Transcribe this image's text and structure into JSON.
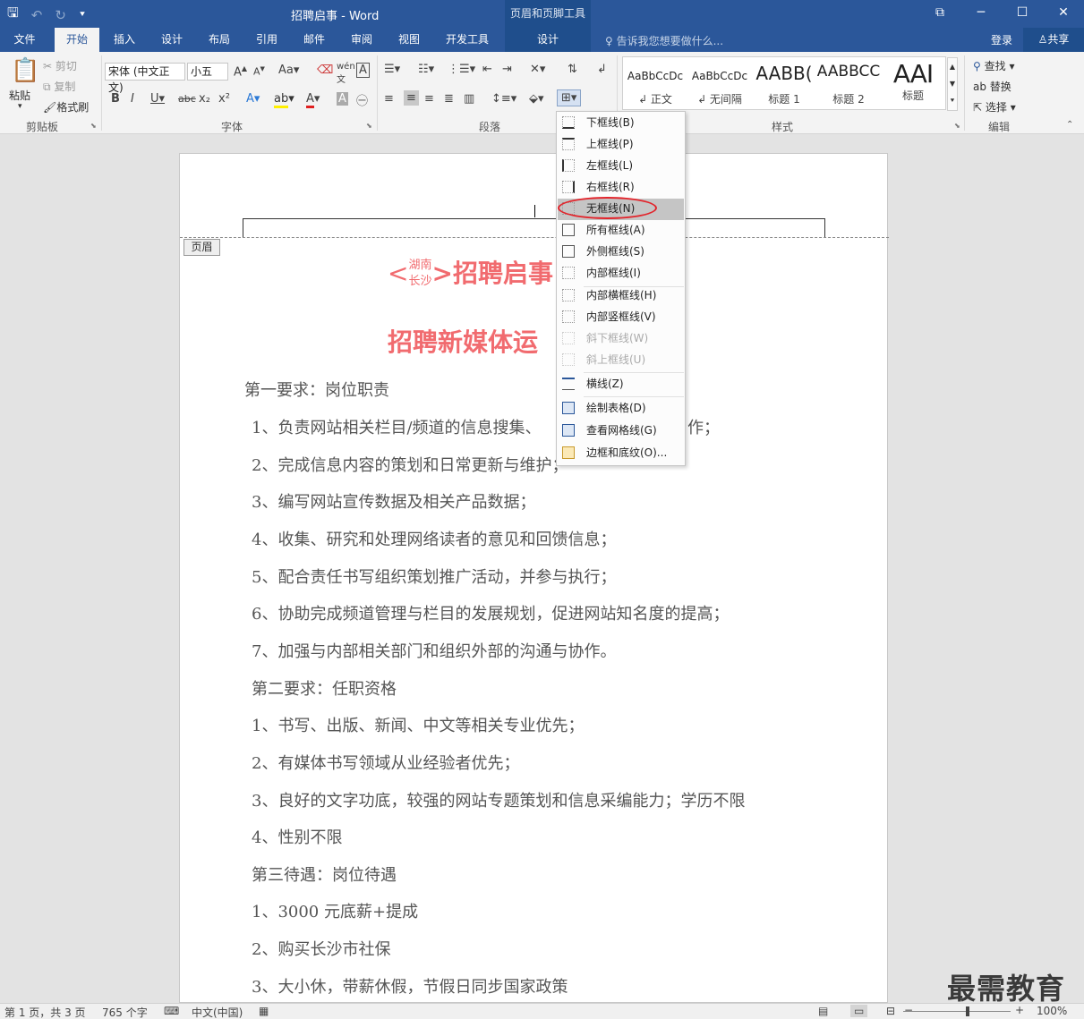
{
  "window": {
    "title": "招聘启事 - Word",
    "context_tab_group": "页眉和页脚工具",
    "controls": [
      "⧉",
      "─",
      "☐",
      "✕"
    ]
  },
  "qat": {
    "save": "🖫",
    "undo": "↶",
    "redo": "↻",
    "customize": "⯆"
  },
  "tabs": [
    "文件",
    "开始",
    "插入",
    "设计",
    "布局",
    "引用",
    "邮件",
    "审阅",
    "视图",
    "开发工具",
    "设计"
  ],
  "active_tab": "开始",
  "tell_me": "告诉我您想要做什么...",
  "signin": "登录",
  "share": "共享",
  "ribbon": {
    "clipboard": {
      "label": "剪贴板",
      "paste": "粘贴",
      "cut": "剪切",
      "copy": "复制",
      "format_painter": "格式刷"
    },
    "font": {
      "label": "字体",
      "font_name": "宋体 (中文正文)",
      "font_size": "小五"
    },
    "paragraph": {
      "label": "段落"
    },
    "styles": {
      "label": "样式",
      "items": [
        {
          "preview": "AaBbCcDc",
          "name": "↲ 正文"
        },
        {
          "preview": "AaBbCcDc",
          "name": "↲ 无间隔"
        },
        {
          "preview": "AABB(",
          "name": "标题 1"
        },
        {
          "preview": "AABBCC",
          "name": "标题 2"
        },
        {
          "preview": "AAI",
          "name": "标题"
        }
      ]
    },
    "editing": {
      "label": "编辑",
      "find": "查找",
      "replace": "替换",
      "select": "选择"
    }
  },
  "document": {
    "header_tag": "页眉",
    "title_left": "<",
    "title_city_top": "湖南",
    "title_city_bottom": "长沙",
    "title_main": ">招聘启事",
    "subtitle": "招聘新媒体运",
    "lines": [
      "第一要求：岗位职责",
      "1、负责网站相关栏目/频道的信息搜集、",
      "作；",
      "2、完成信息内容的策划和日常更新与维护；",
      "3、编写网站宣传数据及相关产品数据；",
      "4、收集、研究和处理网络读者的意见和回馈信息；",
      "5、配合责任书写组织策划推广活动，并参与执行；",
      "6、协助完成频道管理与栏目的发展规划，促进网站知名度的提高；",
      "7、加强与内部相关部门和组织外部的沟通与协作。",
      "第二要求：任职资格",
      "1、书写、出版、新闻、中文等相关专业优先；",
      "2、有媒体书写领域从业经验者优先；",
      "3、良好的文字功底，较强的网站专题策划和信息采编能力；学历不限",
      "4、性别不限",
      "第三待遇：岗位待遇",
      "1、3000 元底薪+提成",
      "2、购买长沙市社保",
      "3、大小休，带薪休假，节假日同步国家政策"
    ]
  },
  "border_menu": {
    "items": [
      {
        "label": "下框线(B)",
        "icon": "bottom-border-icon",
        "state": "normal"
      },
      {
        "label": "上框线(P)",
        "icon": "top-border-icon",
        "state": "normal"
      },
      {
        "label": "左框线(L)",
        "icon": "left-border-icon",
        "state": "normal"
      },
      {
        "label": "右框线(R)",
        "icon": "right-border-icon",
        "state": "normal"
      },
      {
        "label": "无框线(N)",
        "icon": "no-border-icon",
        "state": "highlighted"
      },
      {
        "label": "所有框线(A)",
        "icon": "all-borders-icon",
        "state": "normal"
      },
      {
        "label": "外侧框线(S)",
        "icon": "outside-borders-icon",
        "state": "normal"
      },
      {
        "label": "内部框线(I)",
        "icon": "inside-borders-icon",
        "state": "normal"
      },
      {
        "label": "内部横框线(H)",
        "icon": "inside-horizontal-border-icon",
        "state": "normal"
      },
      {
        "label": "内部竖框线(V)",
        "icon": "inside-vertical-border-icon",
        "state": "normal"
      },
      {
        "label": "斜下框线(W)",
        "icon": "diagonal-down-border-icon",
        "state": "disabled"
      },
      {
        "label": "斜上框线(U)",
        "icon": "diagonal-up-border-icon",
        "state": "disabled"
      },
      {
        "label": "横线(Z)",
        "icon": "horizontal-line-icon",
        "state": "normal"
      },
      {
        "label": "绘制表格(D)",
        "icon": "draw-table-icon",
        "state": "normal"
      },
      {
        "label": "查看网格线(G)",
        "icon": "view-gridlines-icon",
        "state": "normal"
      },
      {
        "label": "边框和底纹(O)...",
        "icon": "borders-shading-icon",
        "state": "normal"
      }
    ]
  },
  "status": {
    "page": "第 1 页，共 3 页",
    "words": "765 个字",
    "language": "中文(中国)",
    "zoom": "100%",
    "zoom_level": 1.0
  },
  "watermark": "最需教育",
  "colors": {
    "title_bar": "#2b579a",
    "accent_red": "#f16b6f",
    "highlight_circle": "#e2242b"
  }
}
